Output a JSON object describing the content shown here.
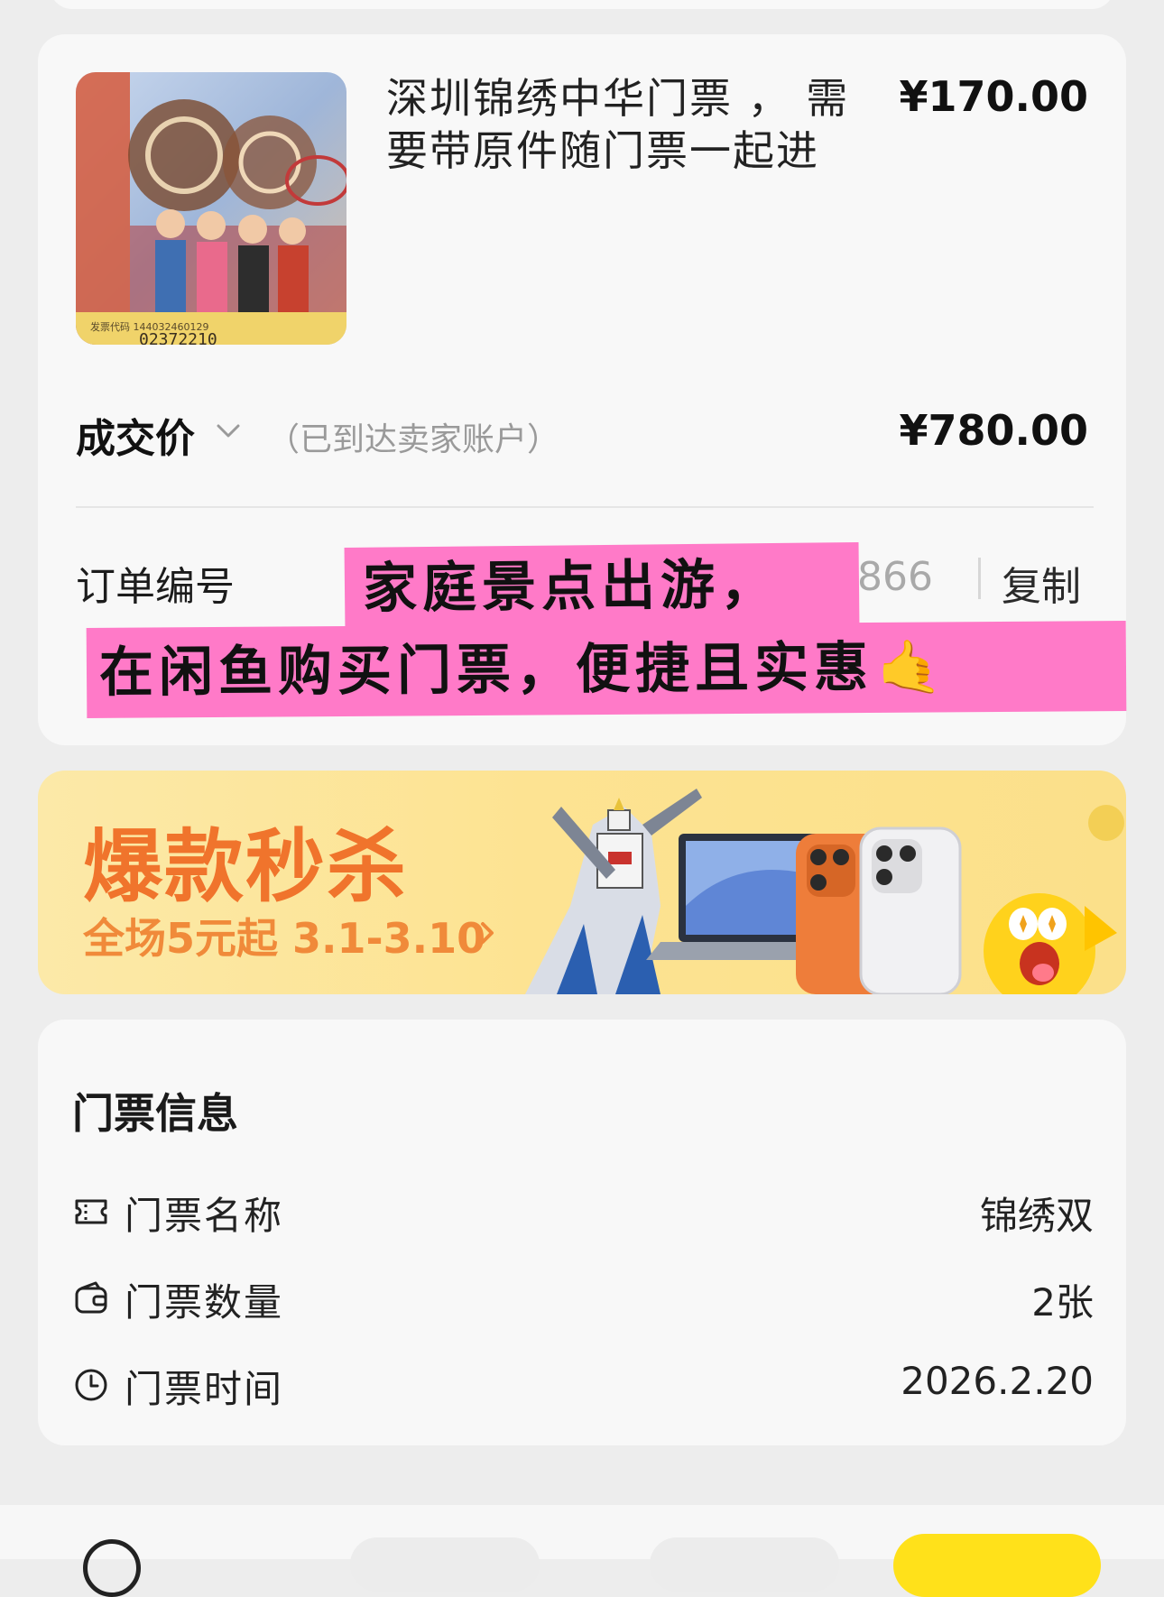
{
  "product": {
    "title": "深圳锦绣中华门票 ， 需要带原件随门票一起进 随…",
    "price": "¥170.00",
    "thumb_code": "发票代码 144032460129",
    "thumb_number": "02372210"
  },
  "deal": {
    "label": "成交价",
    "note": "（已到达卖家账户）",
    "price": "¥780.00"
  },
  "order": {
    "label": "订单编号",
    "number_visible": "866",
    "copy_label": "复制"
  },
  "overlay": {
    "line1": "家庭景点出游，",
    "line2": "在闲鱼购买门票，便捷且实惠",
    "emoji": "🤙"
  },
  "banner": {
    "title": "爆款秒杀",
    "subtitle": "全场5元起 3.1-3.10",
    "colors": {
      "title": "#f0742c",
      "bg": "#fde392"
    }
  },
  "ticket_info": {
    "title": "门票信息",
    "rows": [
      {
        "icon": "ticket-icon",
        "label": "门票名称",
        "value": "锦绣双"
      },
      {
        "icon": "wallet-icon",
        "label": "门票数量",
        "value": "2张"
      },
      {
        "icon": "clock-icon",
        "label": "门票时间",
        "value": "2026.2.20"
      }
    ]
  }
}
